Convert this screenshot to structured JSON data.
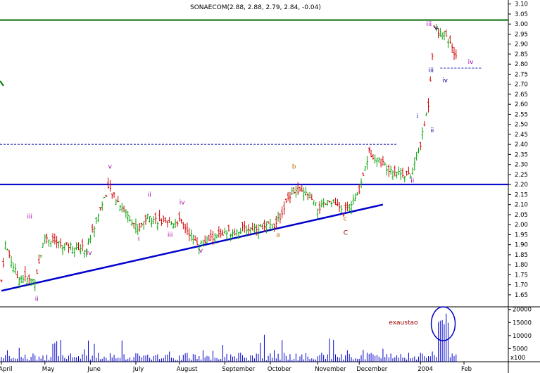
{
  "chart_data": {
    "type": "candlestick",
    "title": "SONAECOM(2.88, 2.88, 2.79, 2.84, -0.04)",
    "price_axis": {
      "min": 1.59,
      "max": 3.12,
      "ticks": [
        "1.65",
        "1.70",
        "1.75",
        "1.80",
        "1.85",
        "1.90",
        "1.95",
        "2.00",
        "2.05",
        "2.10",
        "2.15",
        "2.20",
        "2.25",
        "2.30",
        "2.35",
        "2.40",
        "2.45",
        "2.50",
        "2.55",
        "2.60",
        "2.65",
        "2.70",
        "2.75",
        "2.80",
        "2.85",
        "2.90",
        "2.95",
        "3.00",
        "3.05",
        "3.10"
      ]
    },
    "volume_axis": {
      "min": 0,
      "max": 21000,
      "unit_label": "x100",
      "ticks": [
        "5000",
        "10000",
        "15000",
        "20000"
      ]
    },
    "months": [
      "April",
      "May",
      "June",
      "July",
      "August",
      "September",
      "October",
      "November",
      "December",
      "2004",
      "Feb"
    ],
    "colors": {
      "up": "#00a000",
      "down": "#d00000",
      "volume": "#0000cc",
      "trend": "#0000cc",
      "resistance": "#006400",
      "wave_purple": "#a000a0",
      "wave_blue": "#0000a0",
      "wave_orange": "#cc6600",
      "grid": "#000000"
    },
    "horizontal_levels": [
      {
        "price": 3.02,
        "style": "solid",
        "color": "#006400"
      },
      {
        "price": 2.2,
        "style": "solid",
        "color": "#0000cc"
      },
      {
        "price": 2.4,
        "style": "dashed",
        "color": "#0000a0"
      },
      {
        "price": 2.78,
        "style": "dashed",
        "color": "#0000a0"
      }
    ],
    "trendline": {
      "from": {
        "day": 0,
        "price": 1.67
      },
      "to": {
        "day": 193,
        "price": 2.1
      }
    },
    "wave_labels": [
      {
        "text": "ii",
        "day": 17,
        "price": 1.62,
        "color": "#a000a0"
      },
      {
        "text": "iii",
        "day": 13,
        "price": 2.03,
        "color": "#a000a0"
      },
      {
        "text": "iv",
        "day": 43,
        "price": 1.85,
        "color": "#a000a0"
      },
      {
        "text": "v",
        "day": 54,
        "price": 2.28,
        "color": "#a000a0"
      },
      {
        "text": "i",
        "day": 69,
        "price": 1.92,
        "color": "#a000a0"
      },
      {
        "text": "ii",
        "day": 74,
        "price": 2.14,
        "color": "#a000a0"
      },
      {
        "text": "iii",
        "day": 84,
        "price": 1.94,
        "color": "#a000a0"
      },
      {
        "text": "iv",
        "day": 90,
        "price": 2.1,
        "color": "#a000a0"
      },
      {
        "text": "v",
        "day": 100,
        "price": 1.86,
        "color": "#a000a0"
      },
      {
        "text": "a",
        "day": 139,
        "price": 1.94,
        "color": "#cc6600"
      },
      {
        "text": "b",
        "day": 147,
        "price": 2.28,
        "color": "#cc6600"
      },
      {
        "text": "c",
        "day": 173,
        "price": 2.02,
        "color": "#cc6600"
      },
      {
        "text": "C",
        "day": 173,
        "price": 1.95,
        "color": "#a00000"
      },
      {
        "text": "i",
        "day": 186,
        "price": 2.37,
        "color": "#a000a0"
      },
      {
        "text": "ii",
        "day": 207,
        "price": 2.21,
        "color": "#a000a0"
      },
      {
        "text": "i",
        "day": 210,
        "price": 2.53,
        "color": "#0000a0"
      },
      {
        "text": "ii",
        "day": 217,
        "price": 2.46,
        "color": "#0000a0"
      },
      {
        "text": "iii",
        "day": 216,
        "price": 2.76,
        "color": "#0000a0"
      },
      {
        "text": "iv",
        "day": 223,
        "price": 2.71,
        "color": "#0000a0"
      },
      {
        "text": "iii",
        "day": 215,
        "price": 2.99,
        "color": "#a000a0"
      },
      {
        "text": "v",
        "day": 219,
        "price": 2.97,
        "color": "#0000a0"
      },
      {
        "text": "iv",
        "day": 236,
        "price": 2.8,
        "color": "#a000a0"
      }
    ],
    "volume_annotation": {
      "text": "exaustao",
      "color": "#a00000"
    }
  }
}
